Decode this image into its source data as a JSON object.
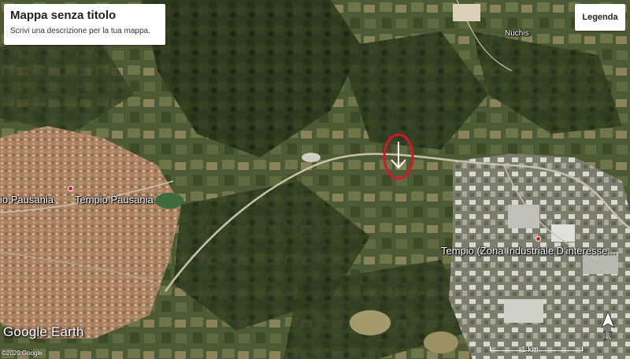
{
  "map": {
    "title": "Mappa senza titolo",
    "description": "Scrivi una descrizione per la tua mappa.",
    "legend_label": "Legenda",
    "places": {
      "nuchis": "Nuchis",
      "tempio_left": "io Pausania",
      "tempio_main": "Tempio Pausania",
      "tempio_industrial": "Tempio (Zona Industriale D'interesse..."
    },
    "scale_label": "1 km",
    "north_label": "N",
    "logo_text": "Google Earth",
    "copyright": "©2020 Google",
    "colors": {
      "marker_circle": "#d4182b",
      "pin": "#d4182b",
      "arrow": "#ffffff"
    },
    "icons": {
      "marker": "down-arrow-in-red-circle",
      "north": "north-arrow-icon",
      "pin": "map-pin-icon"
    }
  }
}
